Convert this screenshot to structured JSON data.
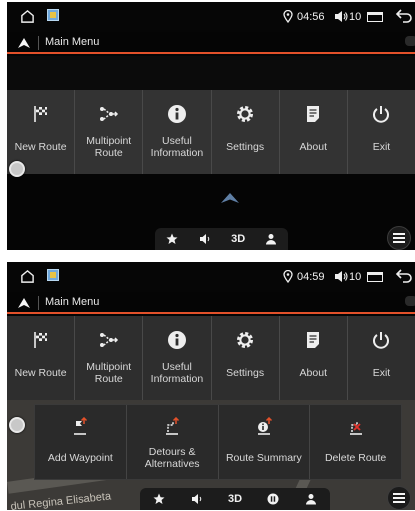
{
  "screens": [
    {
      "status": {
        "time": "04:56",
        "volume": "10"
      },
      "title": "Main Menu",
      "menu": [
        {
          "label": "New Route",
          "icon": "checkered-flag-icon"
        },
        {
          "label": "Multipoint Route",
          "icon": "multipoint-route-icon"
        },
        {
          "label": "Useful Information",
          "icon": "info-icon"
        },
        {
          "label": "Settings",
          "icon": "gear-icon"
        },
        {
          "label": "About",
          "icon": "document-icon"
        },
        {
          "label": "Exit",
          "icon": "power-icon"
        }
      ],
      "toolbar": [
        {
          "icon": "star-icon"
        },
        {
          "icon": "volume-icon"
        },
        {
          "label": "3D"
        },
        {
          "icon": "person-icon"
        }
      ]
    },
    {
      "status": {
        "time": "04:59",
        "volume": "10"
      },
      "title": "Main Menu",
      "menu": [
        {
          "label": "New Route",
          "icon": "checkered-flag-icon"
        },
        {
          "label": "Multipoint Route",
          "icon": "multipoint-route-icon"
        },
        {
          "label": "Useful Information",
          "icon": "info-icon"
        },
        {
          "label": "Settings",
          "icon": "gear-icon"
        },
        {
          "label": "About",
          "icon": "document-icon"
        },
        {
          "label": "Exit",
          "icon": "power-icon"
        }
      ],
      "route_submenu": [
        {
          "label": "Add Waypoint",
          "icon": "add-waypoint-icon"
        },
        {
          "label": "Detours & Alternatives",
          "icon": "detours-icon"
        },
        {
          "label": "Route Summary",
          "icon": "route-summary-icon"
        },
        {
          "label": "Delete Route",
          "icon": "delete-route-icon"
        }
      ],
      "toolbar": [
        {
          "icon": "star-icon"
        },
        {
          "icon": "volume-icon"
        },
        {
          "label": "3D"
        },
        {
          "icon": "pause-icon"
        },
        {
          "icon": "person-icon"
        }
      ],
      "map_street_label": "dul Regina Elisabeta"
    }
  ],
  "colors": {
    "accent": "#e3512a",
    "panel": "#333333",
    "background": "#050505"
  }
}
